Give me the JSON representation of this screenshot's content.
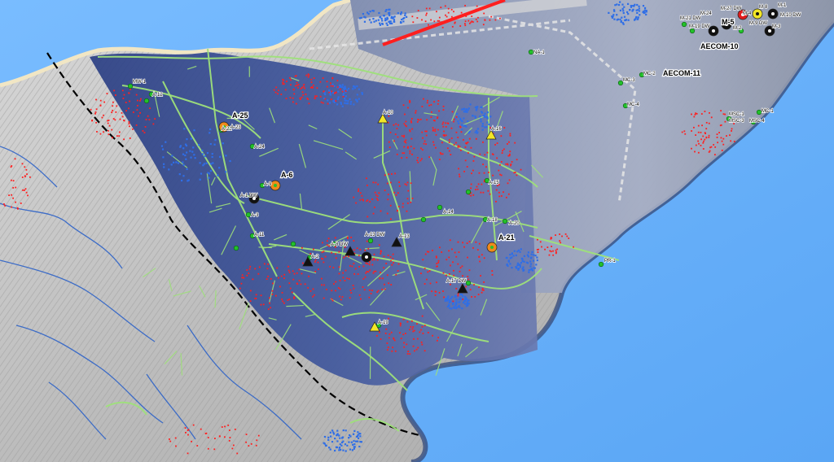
{
  "map": {
    "big_labels": [
      "A-25",
      "A-6",
      "A-21",
      "AECOM-10",
      "AECOM-11",
      "M-5"
    ],
    "small_labels": [
      "A-22",
      "A-23",
      "A-24",
      "A-9",
      "A-11",
      "A-1 DW",
      "A-3",
      "A-2",
      "A-8 DW",
      "A-13 DW",
      "A-13",
      "A-14",
      "A-17 DW",
      "A-10",
      "A-16",
      "A-18",
      "A-20",
      "A-19",
      "A-12",
      "A-15",
      "M-27 DW",
      "M-21 DW",
      "M-19 DW",
      "M-9 DW",
      "M-10 DW",
      "M-8",
      "M-2",
      "M-1",
      "M-3",
      "M-4",
      "M-24",
      "MC-2",
      "MC-3",
      "MC-4",
      "MC-1",
      "MSC-1",
      "MSC-3",
      "MSC-4",
      "NA-1",
      "PR-1",
      "MW-1"
    ],
    "colors": {
      "ocean": "#6fb3ff",
      "terrain": "#c9c9c9",
      "basin": "#3a4f93",
      "facility": "#8c9bb3",
      "roads": "#9ee07a",
      "streams": "#2e63c8",
      "points": "#ff1f1f",
      "buildings": "#2f6ee6",
      "boundary": "#000000",
      "coast": "#f1e6c4"
    },
    "well_symbols": [
      "green-dot",
      "black-triangle",
      "yellow-triangle",
      "black-target",
      "orange-target",
      "red-target",
      "yellow-target"
    ]
  }
}
